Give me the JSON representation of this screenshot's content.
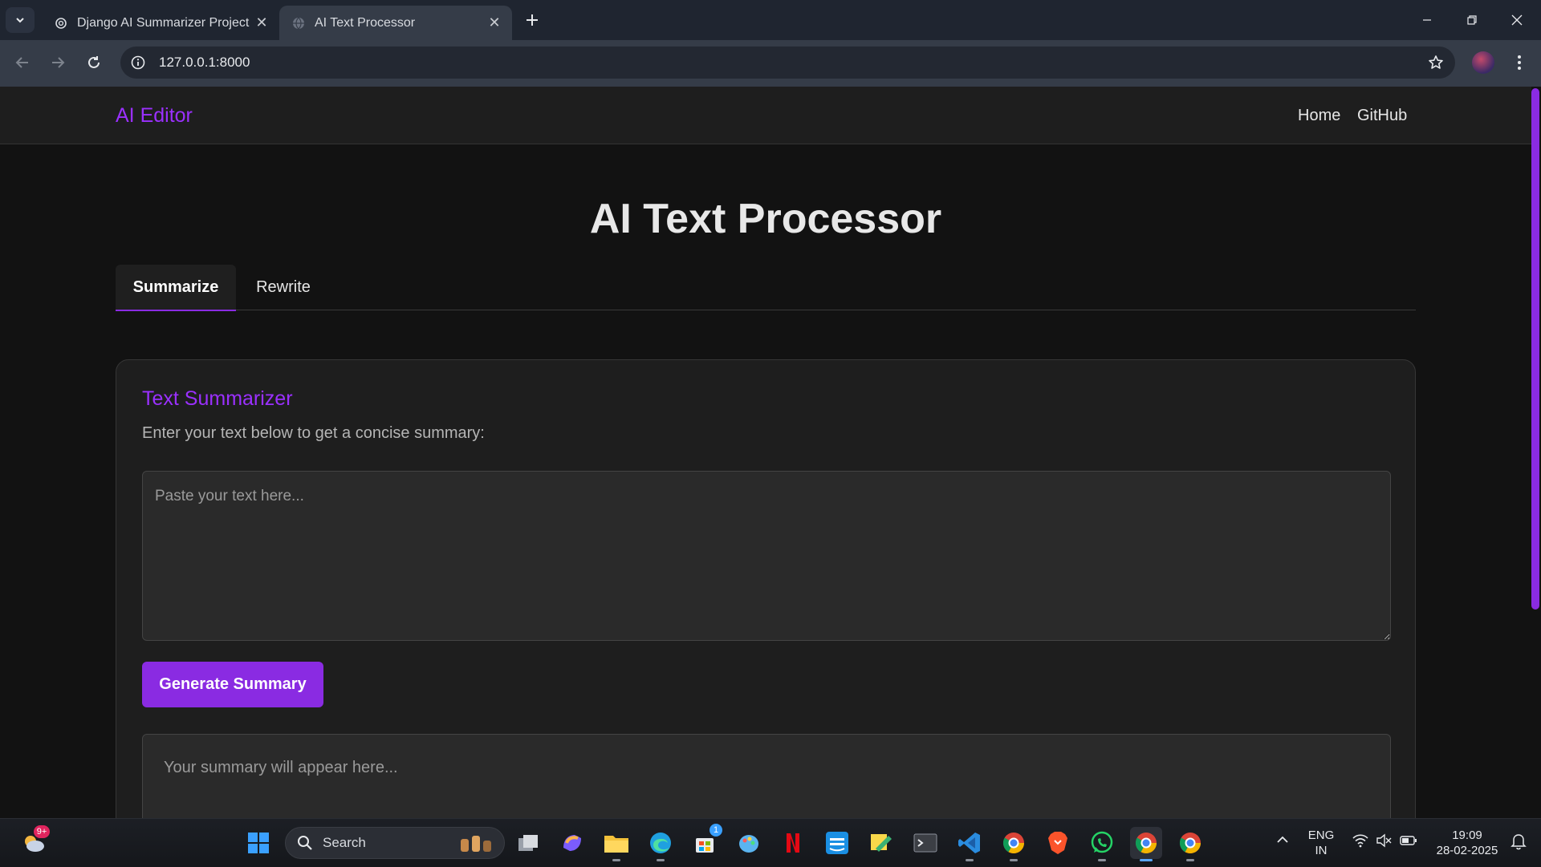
{
  "browser": {
    "tabs": [
      {
        "title": "Django AI Summarizer Project",
        "active": false
      },
      {
        "title": "AI Text Processor",
        "active": true
      }
    ],
    "url": "127.0.0.1:8000"
  },
  "site": {
    "brand": "AI Editor",
    "nav": {
      "home": "Home",
      "github": "GitHub"
    },
    "page_title": "AI Text Processor",
    "tabs": [
      {
        "label": "Summarize",
        "active": true
      },
      {
        "label": "Rewrite",
        "active": false
      }
    ],
    "card": {
      "title": "Text Summarizer",
      "description": "Enter your text below to get a concise summary:",
      "input_placeholder": "Paste your text here...",
      "input_value": "",
      "button_label": "Generate Summary",
      "output_placeholder": "Your summary will appear here..."
    },
    "accent_color": "#8a2be2"
  },
  "taskbar": {
    "search_label": "Search",
    "weather_badge": "9+",
    "store_badge": "1",
    "language": {
      "line1": "ENG",
      "line2": "IN"
    },
    "clock": {
      "time": "19:09",
      "date": "28-02-2025"
    }
  }
}
